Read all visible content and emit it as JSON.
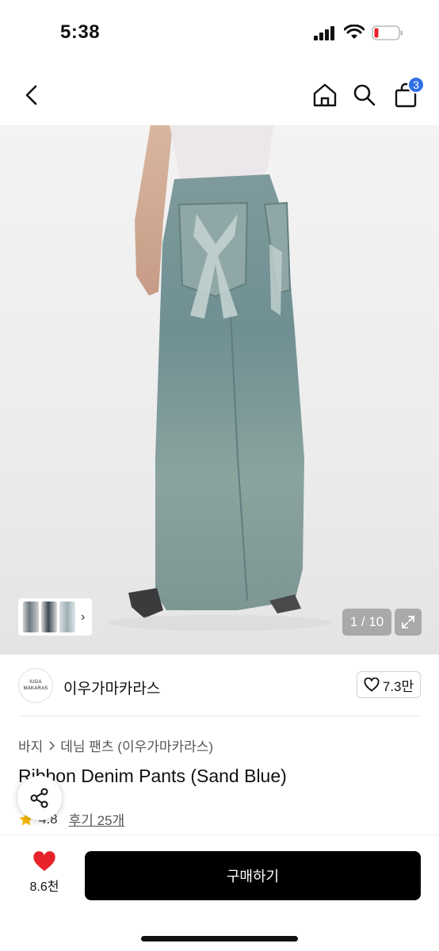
{
  "status_bar": {
    "time": "5:38"
  },
  "nav": {
    "icons": [
      "back-chevron-icon",
      "home-icon",
      "search-icon",
      "shopping-bag-icon"
    ],
    "cart_badge": "3",
    "accent_color": "#2f6fe4"
  },
  "gallery": {
    "page_counter": "1 / 10",
    "thumb_arrow": "›"
  },
  "brand": {
    "logo_line1": "IUGA",
    "logo_line2": "MAKARAS",
    "name": "이우가마카라스",
    "likes": "7.3만"
  },
  "breadcrumb": {
    "category": "바지",
    "subcategory": "데님 팬츠 (이우가마카라스)"
  },
  "product": {
    "title": "Ribbon Denim Pants (Sand Blue)",
    "rating": "4.8",
    "reviews": "후기 25개"
  },
  "bottom_bar": {
    "wish_count": "8.6천",
    "buy_label": "구매하기",
    "heart_color": "#e8222a"
  }
}
